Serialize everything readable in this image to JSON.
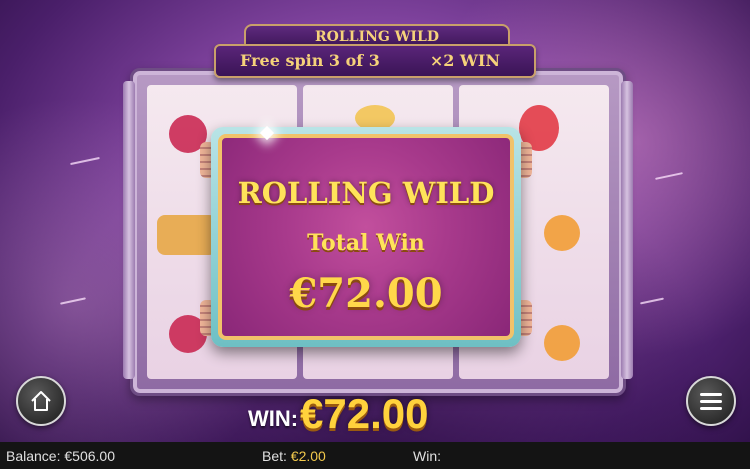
{
  "header": {
    "feature_title": "ROLLING WILD",
    "spin_counter": "Free spin 3 of 3",
    "multiplier_win": "×2 WIN"
  },
  "popup": {
    "title": "ROLLING WILD",
    "subtitle": "Total Win",
    "amount": "€72.00"
  },
  "win_display": {
    "label": "WIN:",
    "amount": "€72.00"
  },
  "bottom_bar": {
    "balance_label": "Balance:",
    "balance_value": "€506.00",
    "bet_label": "Bet:",
    "bet_value": "€2.00",
    "win_label": "Win:",
    "win_value": ""
  },
  "buttons": {
    "home_icon": "home-icon",
    "menu_icon": "hamburger-menu-icon"
  },
  "colors": {
    "accent_gold": "#ffd23c",
    "popup_magenta": "#a83a8c",
    "popup_border_teal": "#6ec0c4",
    "background_purple": "#8a4aa8"
  }
}
